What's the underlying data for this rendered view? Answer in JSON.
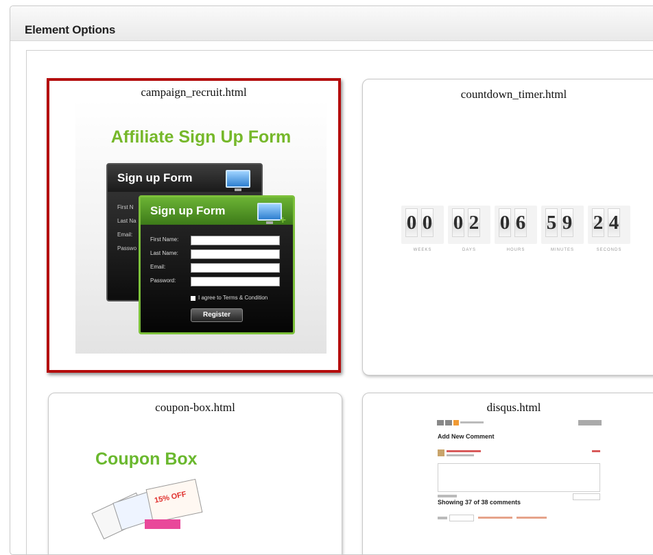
{
  "panel": {
    "title": "Element Options"
  },
  "cards": [
    {
      "filename": "campaign_recruit.html",
      "selected": true,
      "preview": {
        "heading": "Affiliate Sign Up Form",
        "back_form": {
          "title": "Sign up Form",
          "labels": [
            "First N",
            "Last Na",
            "Email:",
            "Passwo"
          ]
        },
        "front_form": {
          "title": "Sign up Form",
          "labels": [
            "First Name:",
            "Last Name:",
            "Email:",
            "Password:"
          ],
          "checkbox_label": "I agree to Terms & Condition",
          "button": "Register"
        }
      }
    },
    {
      "filename": "countdown_timer.html",
      "selected": false,
      "preview": {
        "groups": [
          {
            "digits": [
              "0",
              "0"
            ],
            "unit": "WEEKS"
          },
          {
            "digits": [
              "0",
              "2"
            ],
            "unit": "DAYS"
          },
          {
            "digits": [
              "0",
              "6"
            ],
            "unit": "HOURS"
          },
          {
            "digits": [
              "5",
              "9"
            ],
            "unit": "MINUTES"
          },
          {
            "digits": [
              "2",
              "4"
            ],
            "unit": "SECONDS"
          }
        ]
      }
    },
    {
      "filename": "coupon-box.html",
      "selected": false,
      "preview": {
        "heading": "Coupon Box",
        "coupon_text": "15% OFF"
      }
    },
    {
      "filename": "disqus.html",
      "selected": false,
      "preview": {
        "heading": "Add New Comment",
        "showing": "Showing 37 of 38 comments"
      }
    }
  ],
  "colors": {
    "selected_border": "#b40d0d",
    "brand_green": "#76b82a"
  }
}
